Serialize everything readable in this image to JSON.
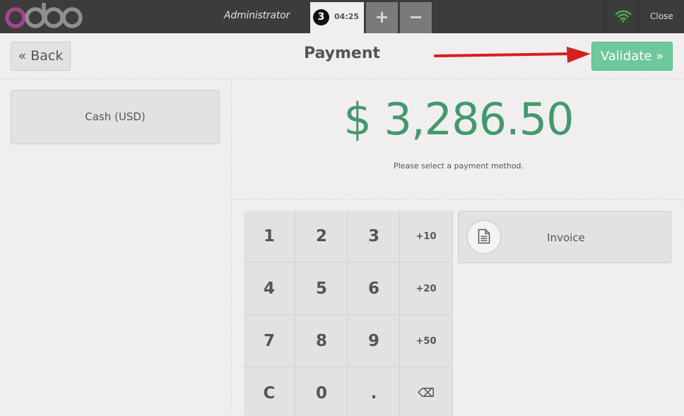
{
  "app": {
    "logo_text": "odoo"
  },
  "topbar": {
    "user": "Administrator",
    "order": {
      "number": "3",
      "time": "04:25"
    },
    "add_label": "+",
    "remove_label": "−",
    "close_label": "Close",
    "wifi_icon": "wifi-icon"
  },
  "header": {
    "back_label": "« Back",
    "title": "Payment",
    "validate_label": "Validate »"
  },
  "payment_methods": [
    {
      "label": "Cash (USD)"
    }
  ],
  "summary": {
    "amount": "$ 3,286.50",
    "hint": "Please select a payment method."
  },
  "numpad": {
    "keys": [
      "1",
      "2",
      "3",
      "+10",
      "4",
      "5",
      "6",
      "+20",
      "7",
      "8",
      "9",
      "+50",
      "C",
      "0",
      ".",
      "⌫"
    ]
  },
  "invoice": {
    "label": "Invoice",
    "icon": "document-icon"
  },
  "colors": {
    "accent": "#43996e",
    "validate": "#6ec89b",
    "arrow": "#d42020"
  }
}
